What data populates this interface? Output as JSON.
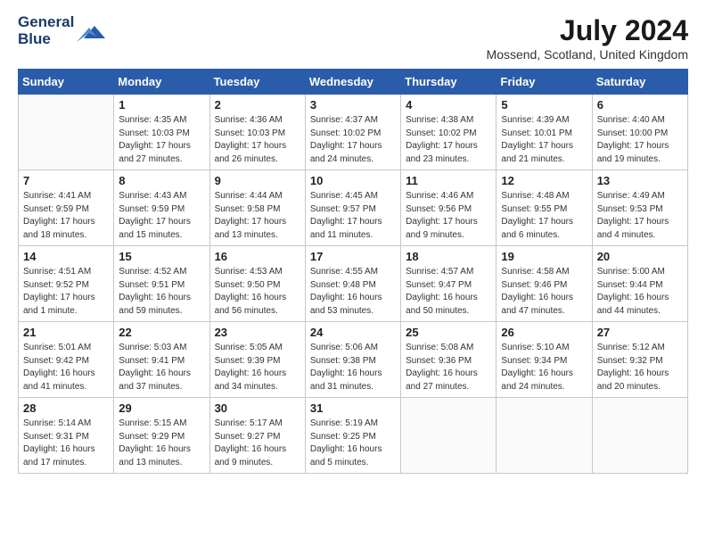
{
  "header": {
    "logo_line1": "General",
    "logo_line2": "Blue",
    "month_title": "July 2024",
    "location": "Mossend, Scotland, United Kingdom"
  },
  "days_of_week": [
    "Sunday",
    "Monday",
    "Tuesday",
    "Wednesday",
    "Thursday",
    "Friday",
    "Saturday"
  ],
  "weeks": [
    [
      {
        "day": "",
        "sunrise": "",
        "sunset": "",
        "daylight": ""
      },
      {
        "day": "1",
        "sunrise": "Sunrise: 4:35 AM",
        "sunset": "Sunset: 10:03 PM",
        "daylight": "Daylight: 17 hours and 27 minutes."
      },
      {
        "day": "2",
        "sunrise": "Sunrise: 4:36 AM",
        "sunset": "Sunset: 10:03 PM",
        "daylight": "Daylight: 17 hours and 26 minutes."
      },
      {
        "day": "3",
        "sunrise": "Sunrise: 4:37 AM",
        "sunset": "Sunset: 10:02 PM",
        "daylight": "Daylight: 17 hours and 24 minutes."
      },
      {
        "day": "4",
        "sunrise": "Sunrise: 4:38 AM",
        "sunset": "Sunset: 10:02 PM",
        "daylight": "Daylight: 17 hours and 23 minutes."
      },
      {
        "day": "5",
        "sunrise": "Sunrise: 4:39 AM",
        "sunset": "Sunset: 10:01 PM",
        "daylight": "Daylight: 17 hours and 21 minutes."
      },
      {
        "day": "6",
        "sunrise": "Sunrise: 4:40 AM",
        "sunset": "Sunset: 10:00 PM",
        "daylight": "Daylight: 17 hours and 19 minutes."
      }
    ],
    [
      {
        "day": "7",
        "sunrise": "Sunrise: 4:41 AM",
        "sunset": "Sunset: 9:59 PM",
        "daylight": "Daylight: 17 hours and 18 minutes."
      },
      {
        "day": "8",
        "sunrise": "Sunrise: 4:43 AM",
        "sunset": "Sunset: 9:59 PM",
        "daylight": "Daylight: 17 hours and 15 minutes."
      },
      {
        "day": "9",
        "sunrise": "Sunrise: 4:44 AM",
        "sunset": "Sunset: 9:58 PM",
        "daylight": "Daylight: 17 hours and 13 minutes."
      },
      {
        "day": "10",
        "sunrise": "Sunrise: 4:45 AM",
        "sunset": "Sunset: 9:57 PM",
        "daylight": "Daylight: 17 hours and 11 minutes."
      },
      {
        "day": "11",
        "sunrise": "Sunrise: 4:46 AM",
        "sunset": "Sunset: 9:56 PM",
        "daylight": "Daylight: 17 hours and 9 minutes."
      },
      {
        "day": "12",
        "sunrise": "Sunrise: 4:48 AM",
        "sunset": "Sunset: 9:55 PM",
        "daylight": "Daylight: 17 hours and 6 minutes."
      },
      {
        "day": "13",
        "sunrise": "Sunrise: 4:49 AM",
        "sunset": "Sunset: 9:53 PM",
        "daylight": "Daylight: 17 hours and 4 minutes."
      }
    ],
    [
      {
        "day": "14",
        "sunrise": "Sunrise: 4:51 AM",
        "sunset": "Sunset: 9:52 PM",
        "daylight": "Daylight: 17 hours and 1 minute."
      },
      {
        "day": "15",
        "sunrise": "Sunrise: 4:52 AM",
        "sunset": "Sunset: 9:51 PM",
        "daylight": "Daylight: 16 hours and 59 minutes."
      },
      {
        "day": "16",
        "sunrise": "Sunrise: 4:53 AM",
        "sunset": "Sunset: 9:50 PM",
        "daylight": "Daylight: 16 hours and 56 minutes."
      },
      {
        "day": "17",
        "sunrise": "Sunrise: 4:55 AM",
        "sunset": "Sunset: 9:48 PM",
        "daylight": "Daylight: 16 hours and 53 minutes."
      },
      {
        "day": "18",
        "sunrise": "Sunrise: 4:57 AM",
        "sunset": "Sunset: 9:47 PM",
        "daylight": "Daylight: 16 hours and 50 minutes."
      },
      {
        "day": "19",
        "sunrise": "Sunrise: 4:58 AM",
        "sunset": "Sunset: 9:46 PM",
        "daylight": "Daylight: 16 hours and 47 minutes."
      },
      {
        "day": "20",
        "sunrise": "Sunrise: 5:00 AM",
        "sunset": "Sunset: 9:44 PM",
        "daylight": "Daylight: 16 hours and 44 minutes."
      }
    ],
    [
      {
        "day": "21",
        "sunrise": "Sunrise: 5:01 AM",
        "sunset": "Sunset: 9:42 PM",
        "daylight": "Daylight: 16 hours and 41 minutes."
      },
      {
        "day": "22",
        "sunrise": "Sunrise: 5:03 AM",
        "sunset": "Sunset: 9:41 PM",
        "daylight": "Daylight: 16 hours and 37 minutes."
      },
      {
        "day": "23",
        "sunrise": "Sunrise: 5:05 AM",
        "sunset": "Sunset: 9:39 PM",
        "daylight": "Daylight: 16 hours and 34 minutes."
      },
      {
        "day": "24",
        "sunrise": "Sunrise: 5:06 AM",
        "sunset": "Sunset: 9:38 PM",
        "daylight": "Daylight: 16 hours and 31 minutes."
      },
      {
        "day": "25",
        "sunrise": "Sunrise: 5:08 AM",
        "sunset": "Sunset: 9:36 PM",
        "daylight": "Daylight: 16 hours and 27 minutes."
      },
      {
        "day": "26",
        "sunrise": "Sunrise: 5:10 AM",
        "sunset": "Sunset: 9:34 PM",
        "daylight": "Daylight: 16 hours and 24 minutes."
      },
      {
        "day": "27",
        "sunrise": "Sunrise: 5:12 AM",
        "sunset": "Sunset: 9:32 PM",
        "daylight": "Daylight: 16 hours and 20 minutes."
      }
    ],
    [
      {
        "day": "28",
        "sunrise": "Sunrise: 5:14 AM",
        "sunset": "Sunset: 9:31 PM",
        "daylight": "Daylight: 16 hours and 17 minutes."
      },
      {
        "day": "29",
        "sunrise": "Sunrise: 5:15 AM",
        "sunset": "Sunset: 9:29 PM",
        "daylight": "Daylight: 16 hours and 13 minutes."
      },
      {
        "day": "30",
        "sunrise": "Sunrise: 5:17 AM",
        "sunset": "Sunset: 9:27 PM",
        "daylight": "Daylight: 16 hours and 9 minutes."
      },
      {
        "day": "31",
        "sunrise": "Sunrise: 5:19 AM",
        "sunset": "Sunset: 9:25 PM",
        "daylight": "Daylight: 16 hours and 5 minutes."
      },
      {
        "day": "",
        "sunrise": "",
        "sunset": "",
        "daylight": ""
      },
      {
        "day": "",
        "sunrise": "",
        "sunset": "",
        "daylight": ""
      },
      {
        "day": "",
        "sunrise": "",
        "sunset": "",
        "daylight": ""
      }
    ]
  ]
}
